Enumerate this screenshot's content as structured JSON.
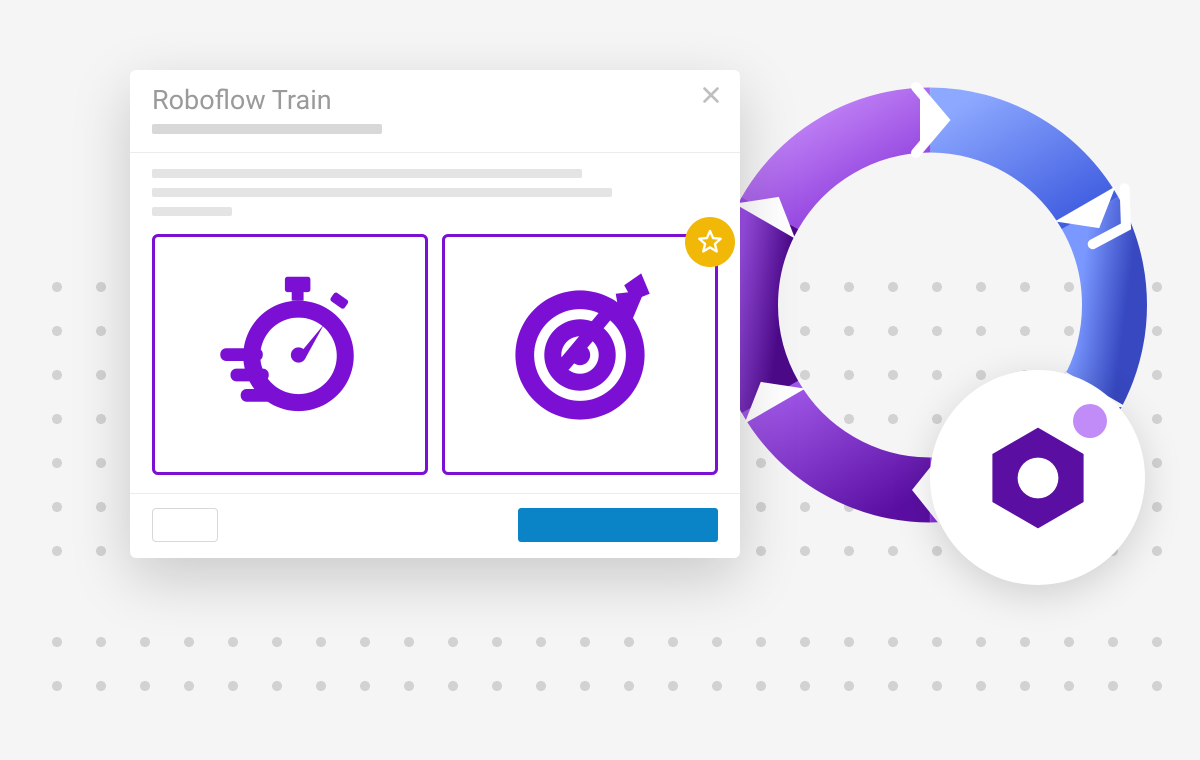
{
  "modal": {
    "title": "Roboflow Train",
    "close_icon": "close-icon",
    "options": [
      {
        "id": "fast",
        "icon": "stopwatch-icon"
      },
      {
        "id": "accurate",
        "icon": "target-icon",
        "featured": true
      }
    ],
    "footer": {
      "secondary_label": "",
      "primary_label": ""
    }
  },
  "badges": {
    "star_icon": "star-icon"
  },
  "logo": {
    "icon": "roboflow-hex-icon"
  },
  "colors": {
    "accent_purple": "#7b10d4",
    "accent_gold": "#f2b807",
    "primary_blue": "#0a84c6",
    "text_muted": "#9a9a9a"
  }
}
